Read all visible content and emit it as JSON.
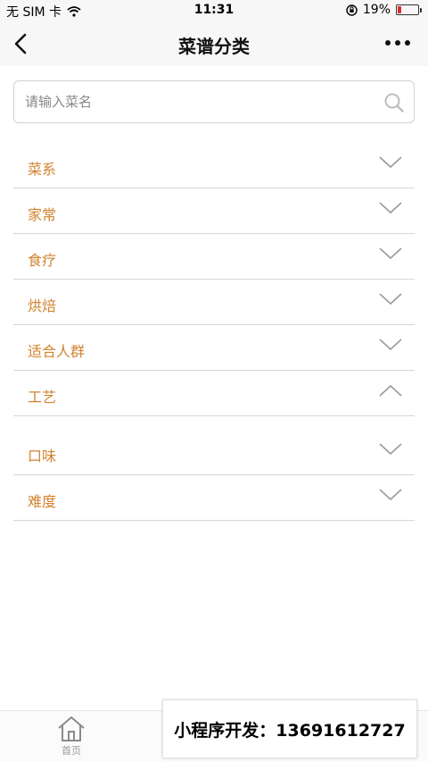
{
  "status_bar": {
    "carrier": "无 SIM 卡",
    "time": "11:31",
    "battery": "19%",
    "battery_level": 0.19
  },
  "nav": {
    "title": "菜谱分类"
  },
  "search": {
    "placeholder": "请输入菜名"
  },
  "categories": [
    {
      "label": "菜系",
      "expanded": false
    },
    {
      "label": "家常",
      "expanded": false
    },
    {
      "label": "食疗",
      "expanded": false
    },
    {
      "label": "烘焙",
      "expanded": false
    },
    {
      "label": "适合人群",
      "expanded": false
    },
    {
      "label": "工艺",
      "expanded": true
    },
    {
      "label": "口味",
      "expanded": false
    },
    {
      "label": "难度",
      "expanded": false
    }
  ],
  "tab_bar": {
    "home_label": "首页"
  },
  "ad": {
    "text": "小程序开发：13691612727"
  },
  "colors": {
    "accent": "#d2832e",
    "battery_low": "#e02a2a"
  }
}
